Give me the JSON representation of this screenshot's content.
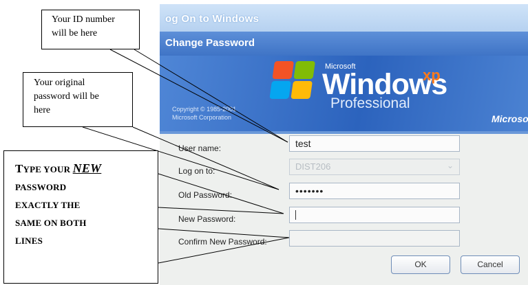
{
  "dialog": {
    "window_title": "og On to Windows",
    "subtitle": "Change Password",
    "branding": {
      "microsoft_small": "Microsoft",
      "windows_word": "Windows",
      "xp": "xp",
      "edition": "Professional",
      "copyright_line1": "Copyright © 1985-2001",
      "copyright_line2": "Microsoft Corporation",
      "microsoft_right": "Microso"
    },
    "fields": {
      "username": {
        "label": "User name:",
        "value": "test"
      },
      "logon_to": {
        "label": "Log on to:",
        "value": "DIST206"
      },
      "old_password": {
        "label": "Old Password:",
        "value": "•••••••"
      },
      "new_password": {
        "label": "New Password:",
        "value": ""
      },
      "confirm_password": {
        "label": "Confirm New Password:",
        "value": ""
      }
    },
    "buttons": {
      "ok": "OK",
      "cancel": "Cancel"
    }
  },
  "callouts": {
    "id": {
      "line1": "Your ID number",
      "line2": "will be here"
    },
    "original": {
      "line1": "Your original",
      "line2": "password will be",
      "line3": "here"
    },
    "new": {
      "t_big": "T",
      "t_rest": "YPE YOUR ",
      "new_word": "NEW",
      "line2": "PASSWORD",
      "line3": "EXACTLY THE",
      "line4": "SAME ON BOTH",
      "line5": "LINES"
    }
  },
  "colors": {
    "title_blue": "#3f74c6",
    "banner_blue": "#2c63bd",
    "xp_orange": "#ff7a1a"
  }
}
